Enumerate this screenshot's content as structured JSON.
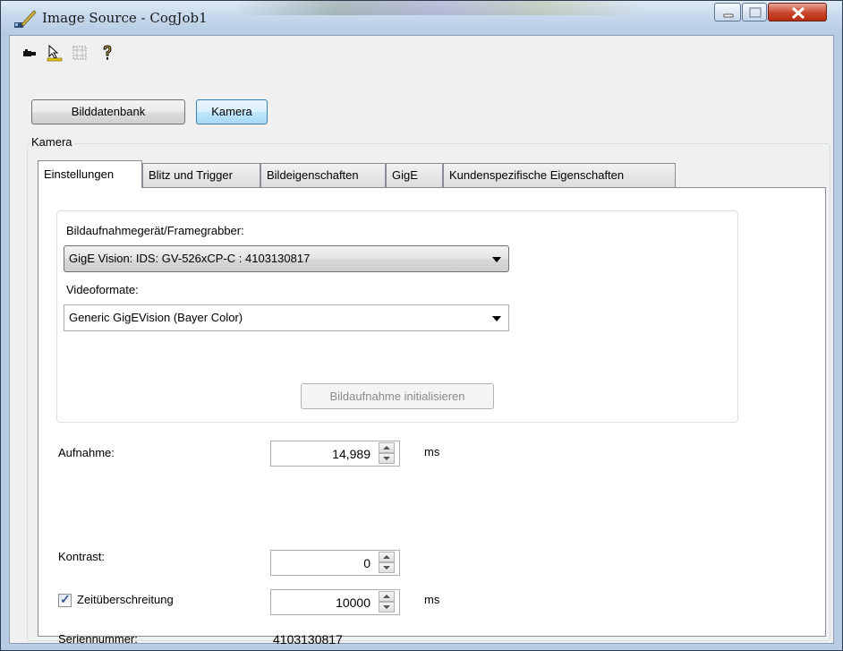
{
  "window": {
    "title": "Image Source - CogJob1"
  },
  "colors": {
    "accent": "#3c7fb1",
    "titlebar": "#c6d8ec",
    "panel": "#ffffff"
  },
  "toolbar": {
    "icons": [
      "camera-icon",
      "edit-icon",
      "grid-icon",
      "help-icon"
    ]
  },
  "source_buttons": {
    "database": "Bilddatenbank",
    "camera": "Kamera"
  },
  "group": {
    "label": "Kamera"
  },
  "tabs": [
    {
      "label": "Einstellungen"
    },
    {
      "label": "Blitz und Trigger"
    },
    {
      "label": "Bildeigenschaften"
    },
    {
      "label": "GigE"
    },
    {
      "label": "Kundenspezifische Eigenschaften"
    }
  ],
  "settings": {
    "grabber_label": "Bildaufnahmegerät/Framegrabber:",
    "grabber_value": "GigE Vision: IDS: GV-526xCP-C : 4103130817",
    "format_label": "Videoformate:",
    "format_value": "Generic GigEVision (Bayer Color)",
    "init_button": "Bildaufnahme initialisieren",
    "exposure_label": "Aufnahme:",
    "exposure_value": "14,989",
    "exposure_unit": "ms",
    "contrast_label": "Kontrast:",
    "contrast_value": "0",
    "timeout_label": "Zeitüberschreitung",
    "timeout_checked": true,
    "timeout_value": "10000",
    "timeout_unit": "ms",
    "serial_label": "Seriennummer:",
    "serial_value": "4103130817"
  }
}
